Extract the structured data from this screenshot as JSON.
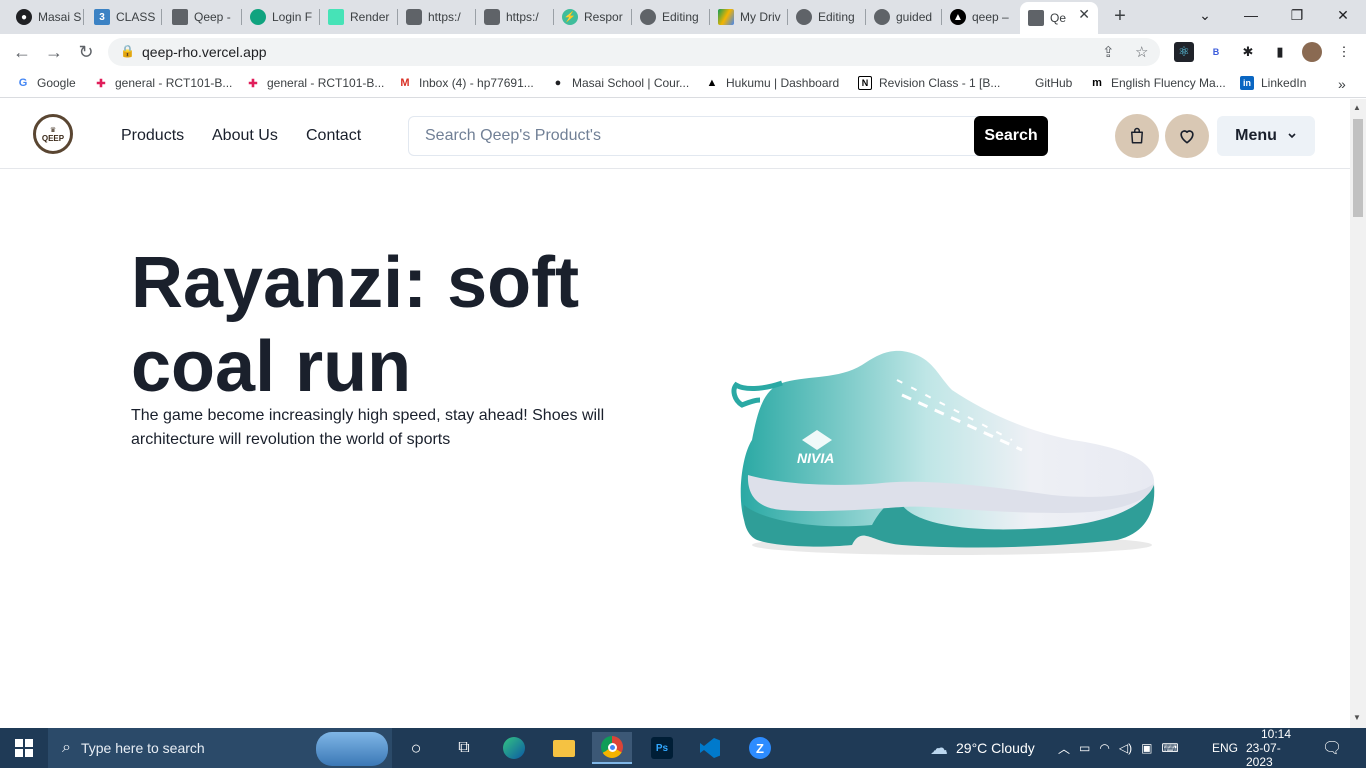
{
  "browser": {
    "tabs": [
      {
        "title": "Masai S",
        "icon": "masai-icon",
        "color": "#202124"
      },
      {
        "title": "CLASS",
        "icon": "three-icon",
        "color": "#3b82c4"
      },
      {
        "title": "Qeep -",
        "icon": "qeep-icon",
        "color": "#5f6368"
      },
      {
        "title": "Login F",
        "icon": "openai-icon",
        "color": "#10a37f"
      },
      {
        "title": "Render",
        "icon": "render-icon",
        "color": "#46e3b7"
      },
      {
        "title": "https:/",
        "icon": "tab-icon",
        "color": "#5f6368"
      },
      {
        "title": "https:/",
        "icon": "tab-icon",
        "color": "#5f6368"
      },
      {
        "title": "Respor",
        "icon": "bolt-icon",
        "color": "#3fbd9b"
      },
      {
        "title": "Editing",
        "icon": "github-icon",
        "color": "#5f6368"
      },
      {
        "title": "My Driv",
        "icon": "drive-icon",
        "color": "#f4b400"
      },
      {
        "title": "Editing",
        "icon": "github-icon",
        "color": "#5f6368"
      },
      {
        "title": "guided",
        "icon": "github-icon",
        "color": "#5f6368"
      },
      {
        "title": "qeep –",
        "icon": "vercel-icon",
        "color": "#000000"
      },
      {
        "title": "Qe",
        "icon": "qeep-icon",
        "color": "#5f6368",
        "active": true
      }
    ],
    "url": "qeep-rho.vercel.app",
    "bookmarks": [
      {
        "label": "Google",
        "icon": "google-icon",
        "color": "#4285f4"
      },
      {
        "label": "general - RCT101-B...",
        "icon": "slack-icon",
        "color": "#e01e5a"
      },
      {
        "label": "general - RCT101-B...",
        "icon": "slack-icon",
        "color": "#e01e5a"
      },
      {
        "label": "Inbox (4) - hp77691...",
        "icon": "gmail-icon",
        "color": "#d93025"
      },
      {
        "label": "Masai School | Cour...",
        "icon": "masai-icon",
        "color": "#202124"
      },
      {
        "label": "Hukumu | Dashboard",
        "icon": "hukumu-icon",
        "color": "#000000"
      },
      {
        "label": "Revision Class - 1 [B...",
        "icon": "notion-icon",
        "color": "#000000"
      },
      {
        "label": "GitHub",
        "icon": "none",
        "color": "#000000"
      },
      {
        "label": "English Fluency Ma...",
        "icon": "medium-icon",
        "color": "#000000"
      },
      {
        "label": "LinkedIn",
        "icon": "linkedin-icon",
        "color": "#0a66c2"
      }
    ],
    "more_bookmarks": "»"
  },
  "site": {
    "logo_text": "QEEP",
    "nav": {
      "products": "Products",
      "about": "About Us",
      "contact": "Contact"
    },
    "search": {
      "placeholder": "Search Qeep's Product's",
      "button": "Search"
    },
    "menu_label": "Menu"
  },
  "hero": {
    "title": "Rayanzi: soft coal run",
    "description": "The game become increasingly high speed, stay ahead! Shoes will architecture will revolution the world of sports",
    "shoe_brand": "NIVIA",
    "accent": "#2aa9a4"
  },
  "taskbar": {
    "search_placeholder": "Type here to search",
    "weather": "29°C  Cloudy",
    "language": "ENG",
    "time": "10:14",
    "date": "23-07-2023"
  }
}
